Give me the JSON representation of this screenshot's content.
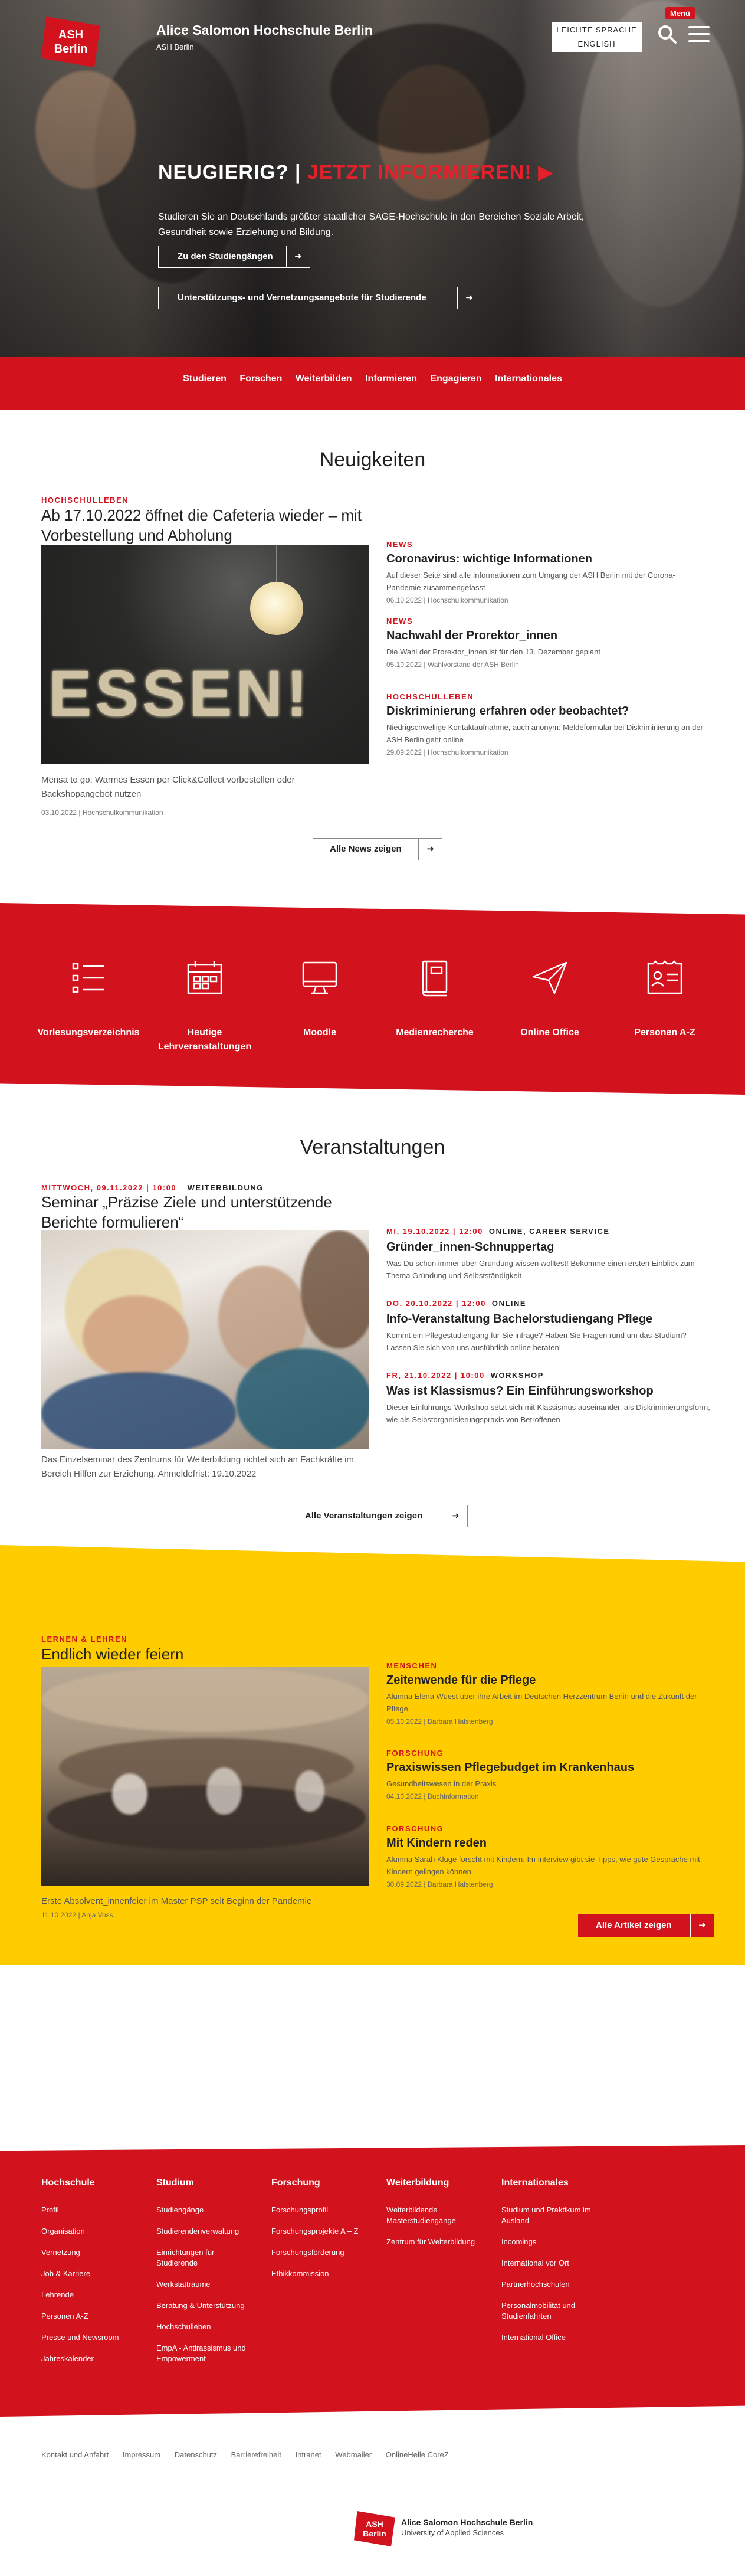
{
  "header": {
    "logo_line1": "ASH",
    "logo_line2": "Berlin",
    "site_title": "Alice Salomon Hochschule Berlin",
    "site_subtitle": "ASH Berlin",
    "lang_easy": "LEICHTE SPRACHE",
    "lang_english": "ENGLISH",
    "menu_label": "Menü"
  },
  "hero": {
    "headline_a": "NEUGIERIG? |",
    "headline_b": "JETZT INFORMIEREN!",
    "text": "Studieren Sie an Deutschlands größter staatlicher SAGE-Hochschule in den Bereichen Soziale Arbeit, Gesundheit sowie Erziehung und Bildung.",
    "btn1": "Zu den Studiengängen",
    "btn2": "Unterstützungs- und Vernetzungsangebote für Studierende"
  },
  "nav": [
    "Studieren",
    "Forschen",
    "Weiterbilden",
    "Informieren",
    "Engagieren",
    "Internationales"
  ],
  "news": {
    "title": "Neuigkeiten",
    "main": {
      "kicker": "HOCHSCHULLEBEN",
      "headline": "Ab 17.10.2022 öffnet die Cafeteria wieder – mit Vorbestellung und Abholung",
      "image_word": "ESSEN!",
      "desc": "Mensa to go: Warmes Essen per Click&Collect vorbestellen oder Backshopangebot nutzen",
      "meta": "03.10.2022 | Hochschulkommunikation"
    },
    "side": [
      {
        "kicker": "NEWS",
        "title": "Coronavirus: wichtige Informationen",
        "desc": "Auf dieser Seite sind alle Informationen zum Umgang der ASH Berlin mit der Corona-Pandemie zusammengefasst",
        "meta": "06.10.2022 | Hochschulkommunikation"
      },
      {
        "kicker": "NEWS",
        "title": "Nachwahl der Prorektor_innen",
        "desc": "Die Wahl der Prorektor_innen ist für den 13. Dezember geplant",
        "meta": "05.10.2022 | Wahlvorstand der ASH Berlin"
      },
      {
        "kicker": "HOCHSCHULLEBEN",
        "title": "Diskriminierung erfahren oder beobachtet?",
        "desc": "Niedrigschwellige Kontaktaufnahme, auch anonym: Meldeformular bei Diskriminierung an der ASH Berlin geht online",
        "meta": "29.09.2022 | Hochschulkommunikation"
      }
    ],
    "all_button": "Alle News zeigen"
  },
  "quicklinks": [
    {
      "icon": "list-icon",
      "label": "Vorlesungsverzeichnis"
    },
    {
      "icon": "calendar-icon",
      "label": "Heutige Lehrveranstaltungen"
    },
    {
      "icon": "monitor-icon",
      "label": "Moodle"
    },
    {
      "icon": "book-icon",
      "label": "Medienrecherche"
    },
    {
      "icon": "paper-plane-icon",
      "label": "Online Office"
    },
    {
      "icon": "id-card-icon",
      "label": "Personen A-Z"
    }
  ],
  "events": {
    "title": "Veranstaltungen",
    "main": {
      "date": "MITTWOCH, 09.11.2022 | 10:00",
      "category": "WEITERBILDUNG",
      "headline": "Seminar „Präzise Ziele und unterstützende Berichte formulieren“",
      "desc": "Das Einzelseminar des Zentrums für Weiterbildung richtet sich an Fachkräfte im Bereich Hilfen zur Erziehung. Anmeldefrist: 19.10.2022"
    },
    "side": [
      {
        "date": "MI, 19.10.2022 | 12:00",
        "category": "ONLINE, CAREER SERVICE",
        "title": "Gründer_innen-Schnuppertag",
        "desc": "Was Du schon immer über Gründung wissen wolltest! Bekomme einen ersten Einblick zum Thema Gründung und Selbstständigkeit"
      },
      {
        "date": "DO, 20.10.2022 | 12:00",
        "category": "ONLINE",
        "title": "Info-Veranstaltung Bachelorstudiengang Pflege",
        "desc": "Kommt ein Pflegestudiengang für Sie infrage? Haben Sie Fragen rund um das Studium? Lassen Sie sich von uns ausführlich online beraten!"
      },
      {
        "date": "FR, 21.10.2022 | 10:00",
        "category": "WORKSHOP",
        "title": "Was ist Klassismus? Ein Einführungsworkshop",
        "desc": "Dieser Einführungs-Workshop setzt sich mit Klassismus auseinander, als Diskriminierungsform, wie als Selbstorganisierungspraxis von Betroffenen"
      }
    ],
    "all_button": "Alle Veranstaltungen zeigen"
  },
  "magazine": {
    "main": {
      "kicker": "LERNEN & LEHREN",
      "headline": "Endlich wieder feiern",
      "desc": "Erste Absolvent_innenfeier im Master PSP seit Beginn der Pandemie",
      "meta": "11.10.2022 | Anja Voss"
    },
    "side": [
      {
        "kicker": "MENSCHEN",
        "title": "Zeitenwende für die Pflege",
        "desc": "Alumna Elena Wuest über ihre Arbeit im Deutschen Herzzentrum Berlin und die Zukunft der Pflege",
        "meta": "05.10.2022 | Barbara Halstenberg"
      },
      {
        "kicker": "FORSCHUNG",
        "title": "Praxiswissen Pflegebudget im Krankenhaus",
        "desc": "Gesundheitswesen in der Praxis",
        "meta": "04.10.2022 | Buchinformation"
      },
      {
        "kicker": "FORSCHUNG",
        "title": "Mit Kindern reden",
        "desc": "Alumna Sarah Kluge forscht mit Kindern. Im Interview gibt sie Tipps, wie gute Gespräche mit Kindern gelingen können",
        "meta": "30.09.2022 | Barbara Halstenberg"
      }
    ],
    "all_button": "Alle Artikel zeigen"
  },
  "footer": {
    "columns": [
      {
        "title": "Hochschule",
        "items": [
          "Profil",
          "Organisation",
          "Vernetzung",
          "Job & Karriere",
          "Lehrende",
          "Personen A-Z",
          "Presse und Newsroom",
          "Jahreskalender"
        ]
      },
      {
        "title": "Studium",
        "items": [
          "Studiengänge",
          "Studierendenverwaltung",
          "Einrichtungen für Studierende",
          "Werkstatträume",
          "Beratung & Unterstützung",
          "Hochschulleben",
          "EmpA - Antirassismus und Empowerment"
        ]
      },
      {
        "title": "Forschung",
        "items": [
          "Forschungsprofil",
          "Forschungsprojekte A – Z",
          "Forschungsförderung",
          "Ethikkommission"
        ]
      },
      {
        "title": "Weiterbildung",
        "items": [
          "Weiterbildende Masterstudiengänge",
          "Zentrum für Weiterbildung"
        ]
      },
      {
        "title": "Internationales",
        "items": [
          "Studium und Praktikum im Ausland",
          "Incomings",
          "International vor Ort",
          "Partnerhochschulen",
          "Personalmobilität und Studienfahrten",
          "International Office"
        ]
      }
    ],
    "bottom_links": [
      "Kontakt und Anfahrt",
      "Impressum",
      "Datenschutz",
      "Barrierefreiheit",
      "Intranet",
      "Webmailer",
      "OnlineHelle CoreZ"
    ],
    "brand_line1": "ASH",
    "brand_line2": "Berlin",
    "brand_name": "Alice Salomon Hochschule Berlin",
    "brand_sub": "University of Applied Sciences"
  }
}
